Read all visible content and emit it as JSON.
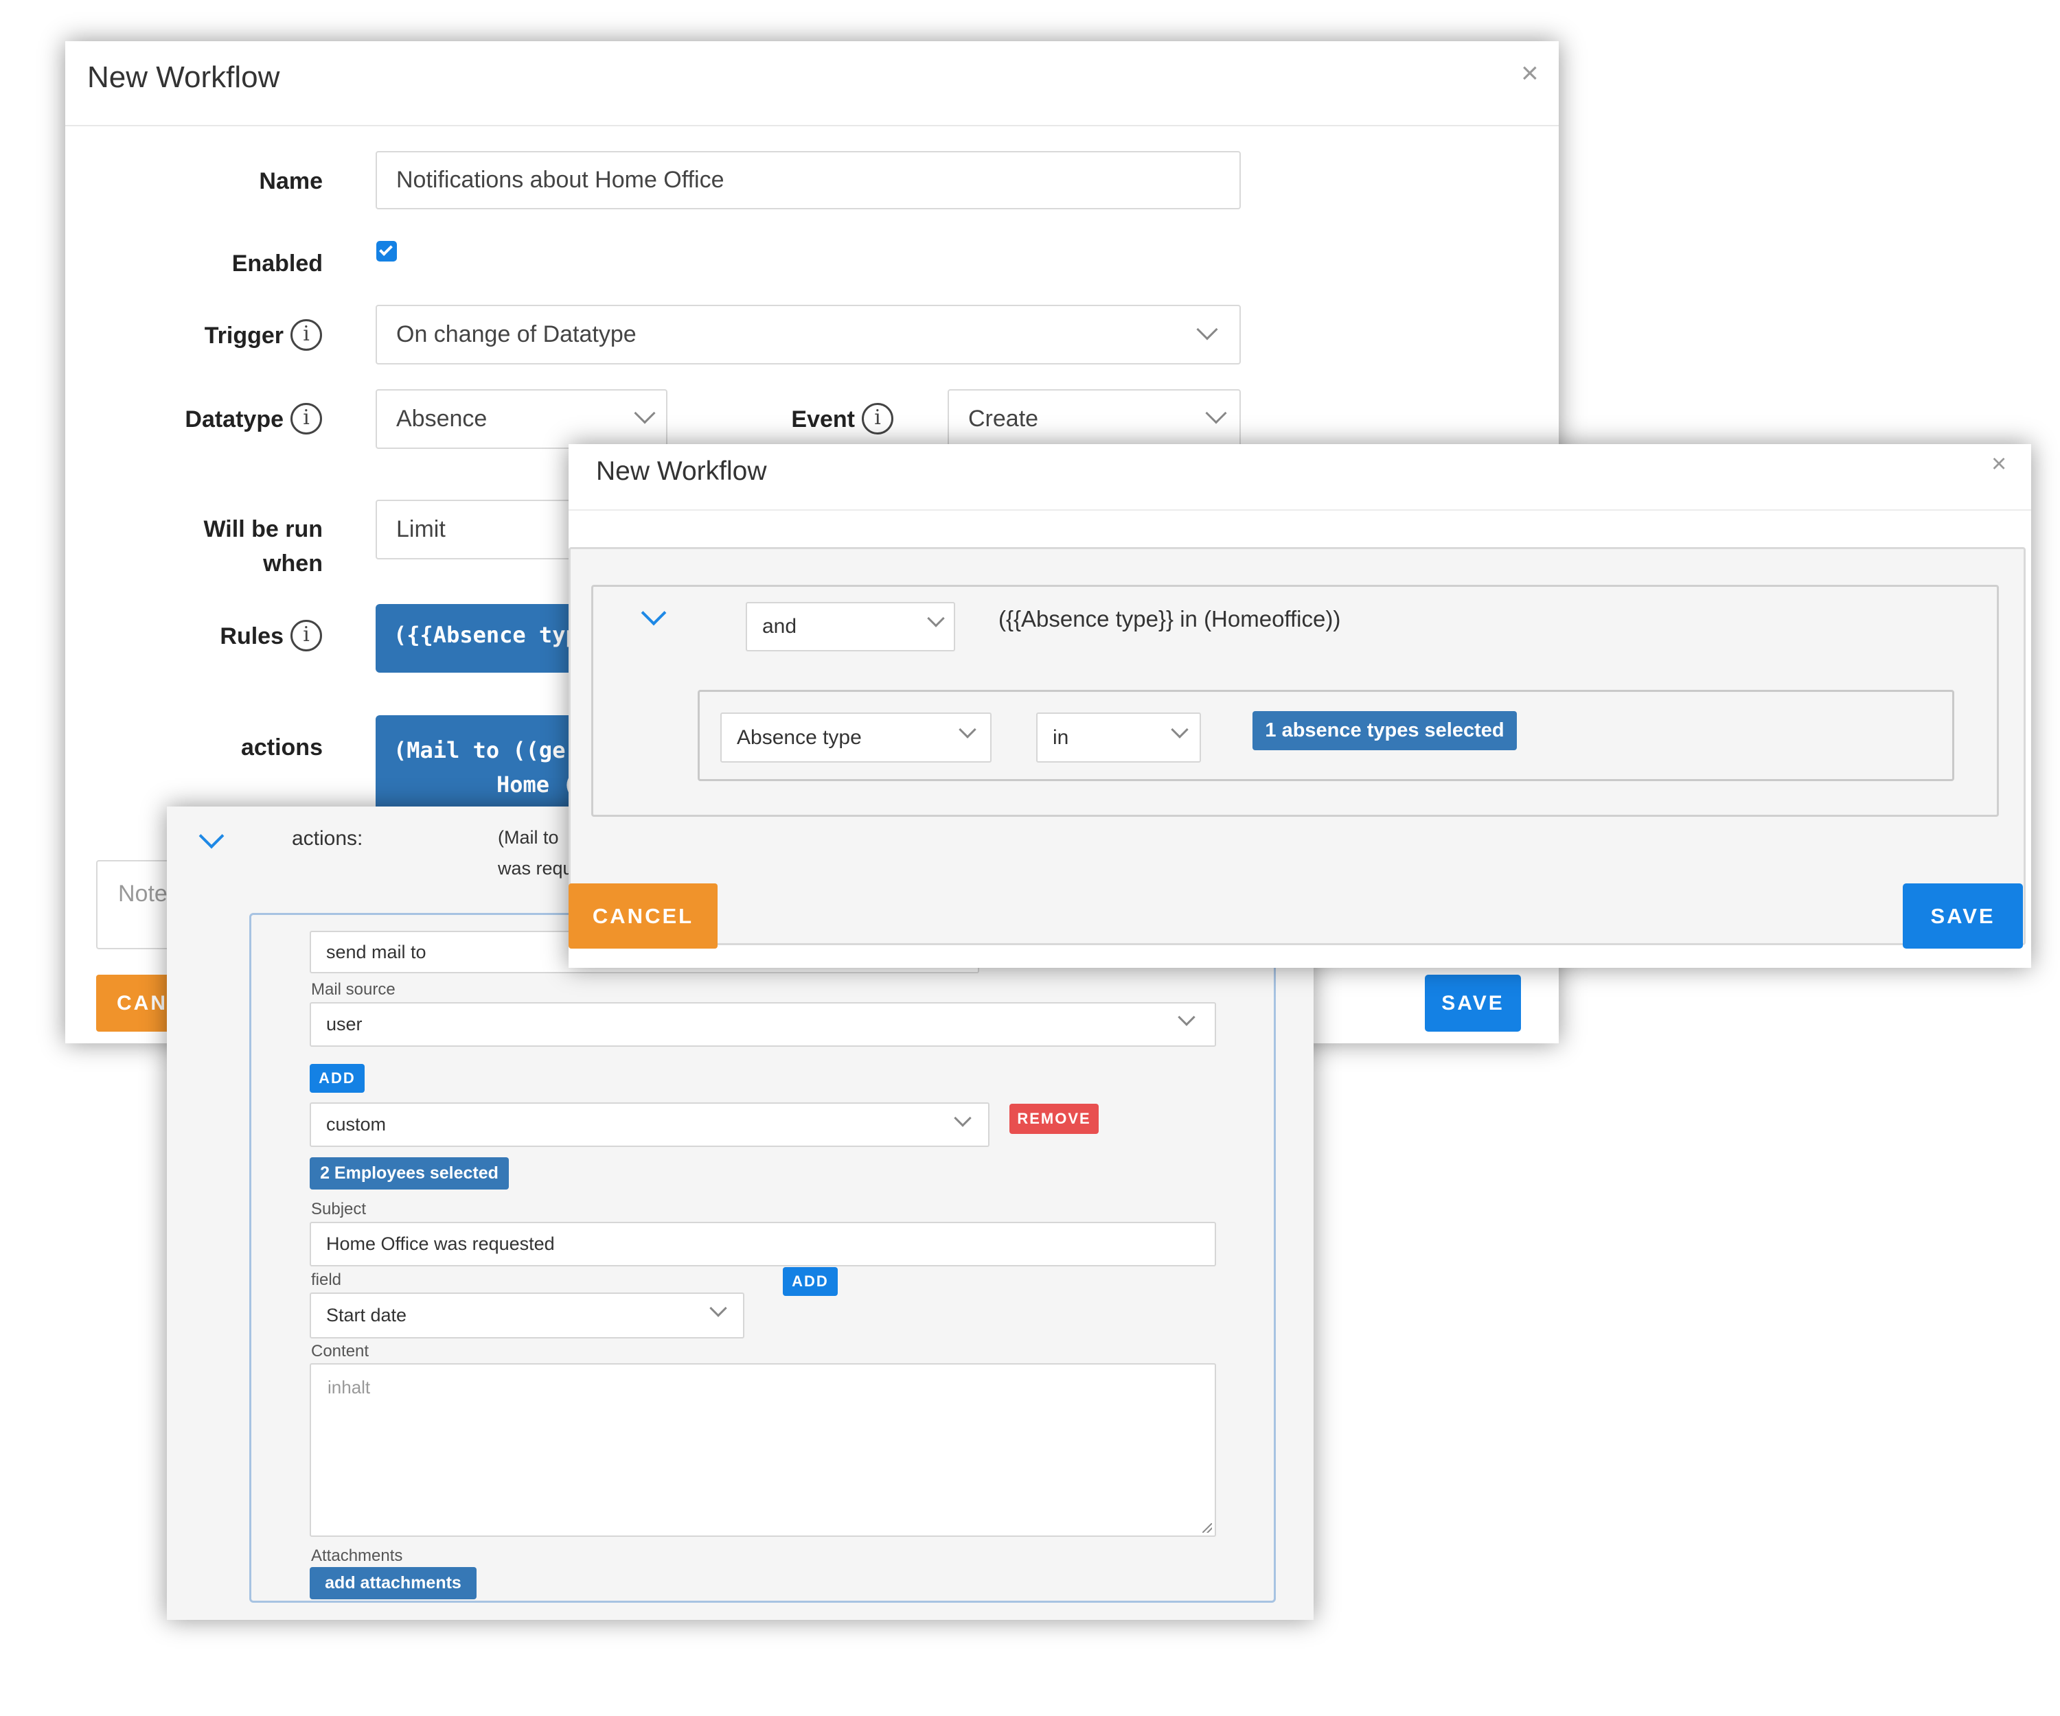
{
  "back_dialog": {
    "title": "New Workflow",
    "close": "×",
    "labels": {
      "name": "Name",
      "enabled": "Enabled",
      "trigger": "Trigger",
      "datatype": "Datatype",
      "event": "Event",
      "will_be_run": "Will be run",
      "when": "when",
      "rules": "Rules",
      "actions": "actions"
    },
    "info_glyph": "i",
    "name_value": "Notifications about Home Office",
    "enabled_checked": true,
    "trigger_value": "On change of Datatype",
    "datatype_value": "Absence",
    "event_value": "Create",
    "limit_value": "Limit",
    "rules_pill": "({{Absence typ",
    "actions_pill_line1": "(Mail to ((ge",
    "actions_pill_line2": "Home (",
    "note_placeholder": "Note",
    "cancel": "CANCEL",
    "save": "SAVE"
  },
  "actions_panel": {
    "header_label": "actions:",
    "summary_line1": "(Mail to",
    "summary_line2": "was requ",
    "send_mail_to": "send mail to",
    "mail_source_label": "Mail source",
    "mail_source_value": "user",
    "add": "ADD",
    "custom_value": "custom",
    "remove": "REMOVE",
    "employees_selected": "2 Employees selected",
    "subject_label": "Subject",
    "subject_value": "Home Office was requested",
    "field_label": "field",
    "field_value": "Start date",
    "content_label": "Content",
    "content_placeholder": "inhalt",
    "attachments_label": "Attachments",
    "add_attachments": "add attachments"
  },
  "rules_dialog": {
    "title": "New Workflow",
    "close": "×",
    "operator_value": "and",
    "rule_summary": "({{Absence type}} in (Homeoffice))",
    "condition_field": "Absence type",
    "condition_operator": "in",
    "condition_value": "1 absence types selected",
    "cancel": "CANCEL",
    "save": "SAVE"
  },
  "colors": {
    "primary_blue": "#1481e4",
    "tag_blue": "#3678b6",
    "orange": "#f0932b",
    "remove_red": "#e84f4f"
  },
  "icons": [
    "close-icon",
    "info-icon",
    "chevron-down-icon",
    "checkbox-icon",
    "resize-handle-icon"
  ]
}
